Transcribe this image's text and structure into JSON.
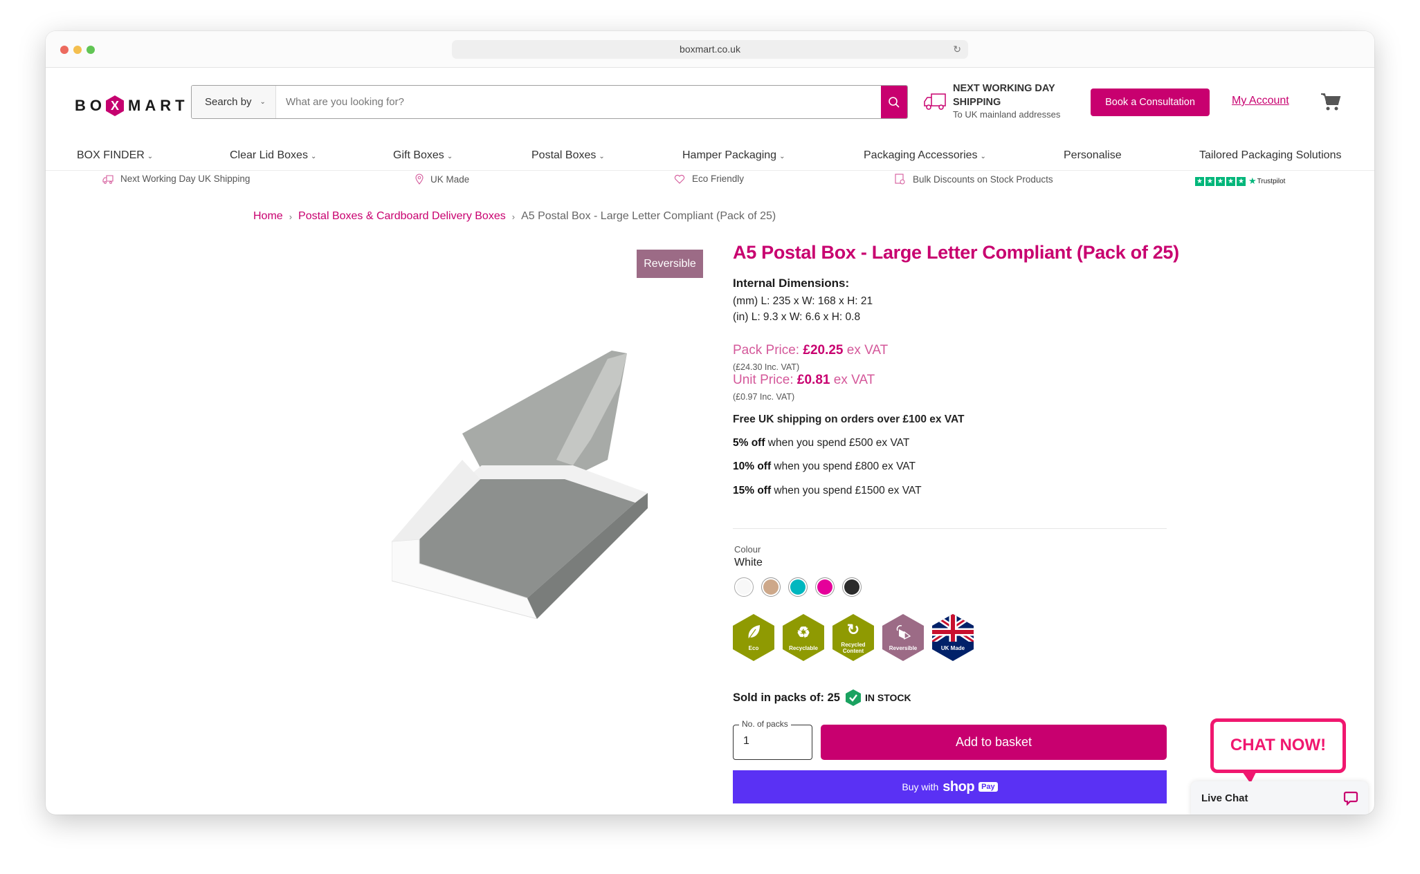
{
  "browser": {
    "url": "boxmart.co.uk"
  },
  "header": {
    "logo_text_left": "BO",
    "logo_x": "X",
    "logo_text_right": "MART",
    "search_by_label": "Search by",
    "search_placeholder": "What are you looking for?",
    "search_value": "",
    "shipping_title": "NEXT WORKING DAY SHIPPING",
    "shipping_subtitle": "To UK mainland addresses",
    "consult_button": "Book a Consultation",
    "account_link": "My Account"
  },
  "nav": {
    "items": [
      {
        "label": "BOX FINDER",
        "dropdown": true
      },
      {
        "label": "Clear Lid Boxes",
        "dropdown": true
      },
      {
        "label": "Gift Boxes",
        "dropdown": true
      },
      {
        "label": "Postal Boxes",
        "dropdown": true
      },
      {
        "label": "Hamper Packaging",
        "dropdown": true
      },
      {
        "label": "Packaging Accessories",
        "dropdown": true
      },
      {
        "label": "Personalise",
        "dropdown": false
      },
      {
        "label": "Tailored Packaging Solutions",
        "dropdown": false
      }
    ]
  },
  "usps": [
    {
      "icon": "truck-icon",
      "label": "Next Working Day UK Shipping"
    },
    {
      "icon": "location-pin-icon",
      "label": "UK Made"
    },
    {
      "icon": "heart-icon",
      "label": "Eco Friendly"
    },
    {
      "icon": "discount-tag-icon",
      "label": "Bulk Discounts on Stock Products"
    }
  ],
  "trustpilot": {
    "rating_stars": 5,
    "label": "Trustpilot"
  },
  "breadcrumb": {
    "items": [
      {
        "label": "Home",
        "link": true
      },
      {
        "label": "Postal Boxes & Cardboard Delivery Boxes",
        "link": true
      },
      {
        "label": "A5 Postal Box - Large Letter Compliant (Pack of 25)",
        "link": false
      }
    ]
  },
  "product": {
    "badge": "Reversible",
    "title": "A5 Postal Box - Large Letter Compliant (Pack of 25)",
    "dimensions_heading": "Internal Dimensions:",
    "dimensions_mm": "(mm)  L: 235 x W: 168 x H: 21",
    "dimensions_in": "(in)  L: 9.3 x W: 6.6 x H: 0.8",
    "pack_price_label": "Pack Price: ",
    "pack_price": "£20.25",
    "pack_price_suffix": " ex VAT",
    "pack_price_inc": "(£24.30 Inc. VAT)",
    "unit_price_label": "Unit Price: ",
    "unit_price": "£0.81",
    "unit_price_suffix": " ex VAT",
    "unit_price_inc": "(£0.97 Inc. VAT)",
    "free_shipping": "Free UK shipping on orders over £100 ex VAT",
    "discounts": [
      {
        "bold": "5% off",
        "text": " when you spend £500 ex VAT"
      },
      {
        "bold": "10% off",
        "text": " when you spend £800 ex VAT"
      },
      {
        "bold": "15% off",
        "text": " when you spend £1500 ex VAT"
      }
    ],
    "colour_label": "Colour",
    "colour_value": "White",
    "colours": [
      {
        "name": "White",
        "hex": "#f8f8f8",
        "selected": true
      },
      {
        "name": "Kraft",
        "hex": "#cda88a",
        "selected": false
      },
      {
        "name": "Teal",
        "hex": "#00b7bf",
        "selected": false
      },
      {
        "name": "Pink",
        "hex": "#e5009a",
        "selected": false
      },
      {
        "name": "Black",
        "hex": "#2b2b2b",
        "selected": false
      }
    ],
    "feature_badges": [
      {
        "label": "Eco",
        "icon": "leaf-icon",
        "color": "#8f9a02"
      },
      {
        "label": "Recyclable",
        "icon": "recycle-icon",
        "color": "#8f9a02"
      },
      {
        "label": "Recycled Content",
        "icon": "recycled-content-icon",
        "color": "#8f9a02"
      },
      {
        "label": "Reversible",
        "icon": "reversible-icon",
        "color": "#9c6b86"
      },
      {
        "label": "UK Made",
        "icon": "union-jack-icon",
        "color": "#012169"
      }
    ],
    "packs_label": "Sold in packs of: 25",
    "stock_status": "IN STOCK",
    "qty_legend": "No. of packs",
    "qty_value": "1",
    "add_to_basket": "Add to basket",
    "shoppay_prefix": "Buy with",
    "shoppay_shop": "shop",
    "shoppay_pay": "Pay"
  },
  "chat": {
    "bubble": "CHAT NOW!",
    "bar_label": "Live Chat"
  },
  "colors": {
    "brand": "#c8006f",
    "shoppay": "#5a31f4",
    "chat": "#f0176f",
    "stock_green": "#1aa260",
    "eco_olive": "#8f9a02",
    "reversible_mauve": "#9c6b86"
  }
}
